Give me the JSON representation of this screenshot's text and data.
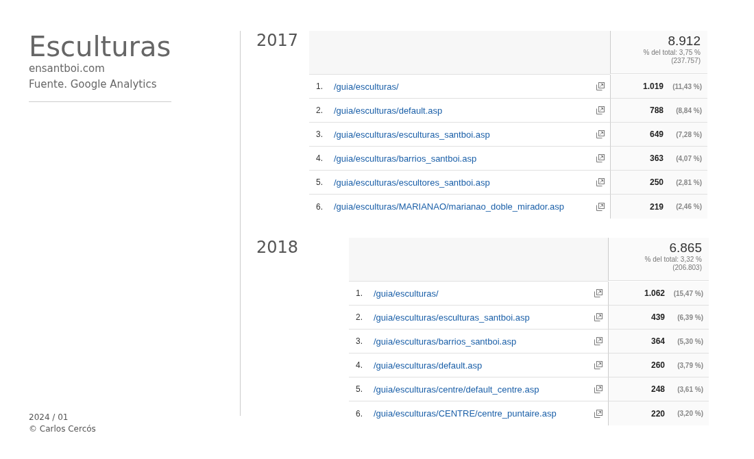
{
  "title": "Esculturas",
  "site": "ensantboi.com",
  "source": "Fuente. Google Analytics",
  "date": "2024 / 01",
  "copyright": "© Carlos Cercós",
  "sections": [
    {
      "year": "2017",
      "total": "8.912",
      "total_share": "% del total: 3,75 %",
      "total_all": "(237.757)",
      "rows": [
        {
          "rank": "1.",
          "page": "/guia/esculturas/",
          "views": "1.019",
          "share": "(11,43 %)"
        },
        {
          "rank": "2.",
          "page": "/guia/esculturas/default.asp",
          "views": "788",
          "share": "(8,84 %)"
        },
        {
          "rank": "3.",
          "page": "/guia/esculturas/esculturas_santboi.asp",
          "views": "649",
          "share": "(7,28 %)"
        },
        {
          "rank": "4.",
          "page": "/guia/esculturas/barrios_santboi.asp",
          "views": "363",
          "share": "(4,07 %)"
        },
        {
          "rank": "5.",
          "page": "/guia/esculturas/escultores_santboi.asp",
          "views": "250",
          "share": "(2,81 %)"
        },
        {
          "rank": "6.",
          "page": "/guia/esculturas/MARIANAO/marianao_doble_mirador.asp",
          "views": "219",
          "share": "(2,46 %)"
        }
      ]
    },
    {
      "year": "2018",
      "total": "6.865",
      "total_share": "% del total: 3,32 %",
      "total_all": "(206.803)",
      "rows": [
        {
          "rank": "1.",
          "page": "/guia/esculturas/",
          "views": "1.062",
          "share": "(15,47 %)"
        },
        {
          "rank": "2.",
          "page": "/guia/esculturas/esculturas_santboi.asp",
          "views": "439",
          "share": "(6,39 %)"
        },
        {
          "rank": "3.",
          "page": "/guia/esculturas/barrios_santboi.asp",
          "views": "364",
          "share": "(5,30 %)"
        },
        {
          "rank": "4.",
          "page": "/guia/esculturas/default.asp",
          "views": "260",
          "share": "(3,79 %)"
        },
        {
          "rank": "5.",
          "page": "/guia/esculturas/centre/default_centre.asp",
          "views": "248",
          "share": "(3,61 %)"
        },
        {
          "rank": "6.",
          "page": "/guia/esculturas/CENTRE/centre_puntaire.asp",
          "views": "220",
          "share": "(3,20 %)"
        }
      ]
    }
  ]
}
